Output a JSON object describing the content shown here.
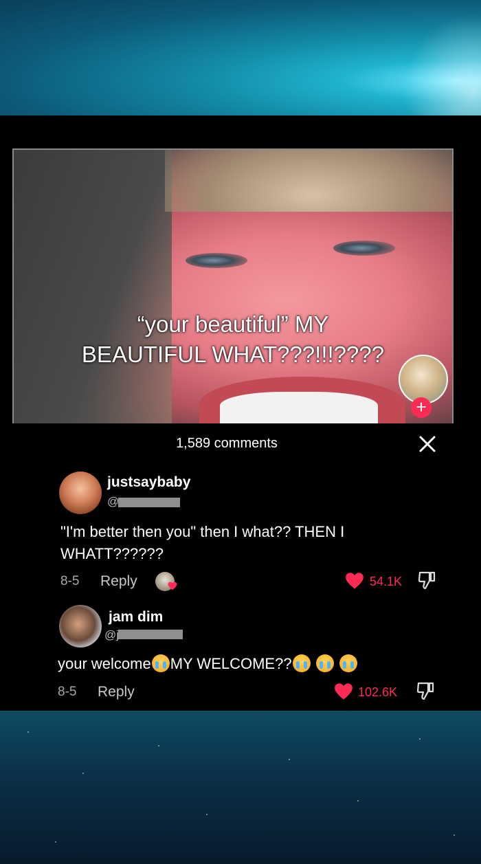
{
  "video": {
    "caption_line1": "“your beautiful” MY",
    "caption_line2": "BEAUTIFUL WHAT???!!!????"
  },
  "comments_panel": {
    "title": "1,589 comments",
    "comments": [
      {
        "username": "justsaybaby",
        "handle": "@",
        "text_line1": "\"I'm better then you\" then I what?? THEN I",
        "text_line2": "WHATT??????",
        "date": "8-5",
        "reply_label": "Reply",
        "likes": "54.1K"
      },
      {
        "username": "jam dim",
        "handle": "@j",
        "text_a": "your welcome",
        "text_b": "MY WELCOME??",
        "date": "8-5",
        "reply_label": "Reply",
        "likes": "102.6K"
      }
    ]
  },
  "colors": {
    "accent": "#fe2c55",
    "panel_bg": "#000000"
  },
  "icons": [
    "plus-icon",
    "close-icon",
    "heart-icon",
    "dislike-icon",
    "crying-emoji-icon"
  ]
}
